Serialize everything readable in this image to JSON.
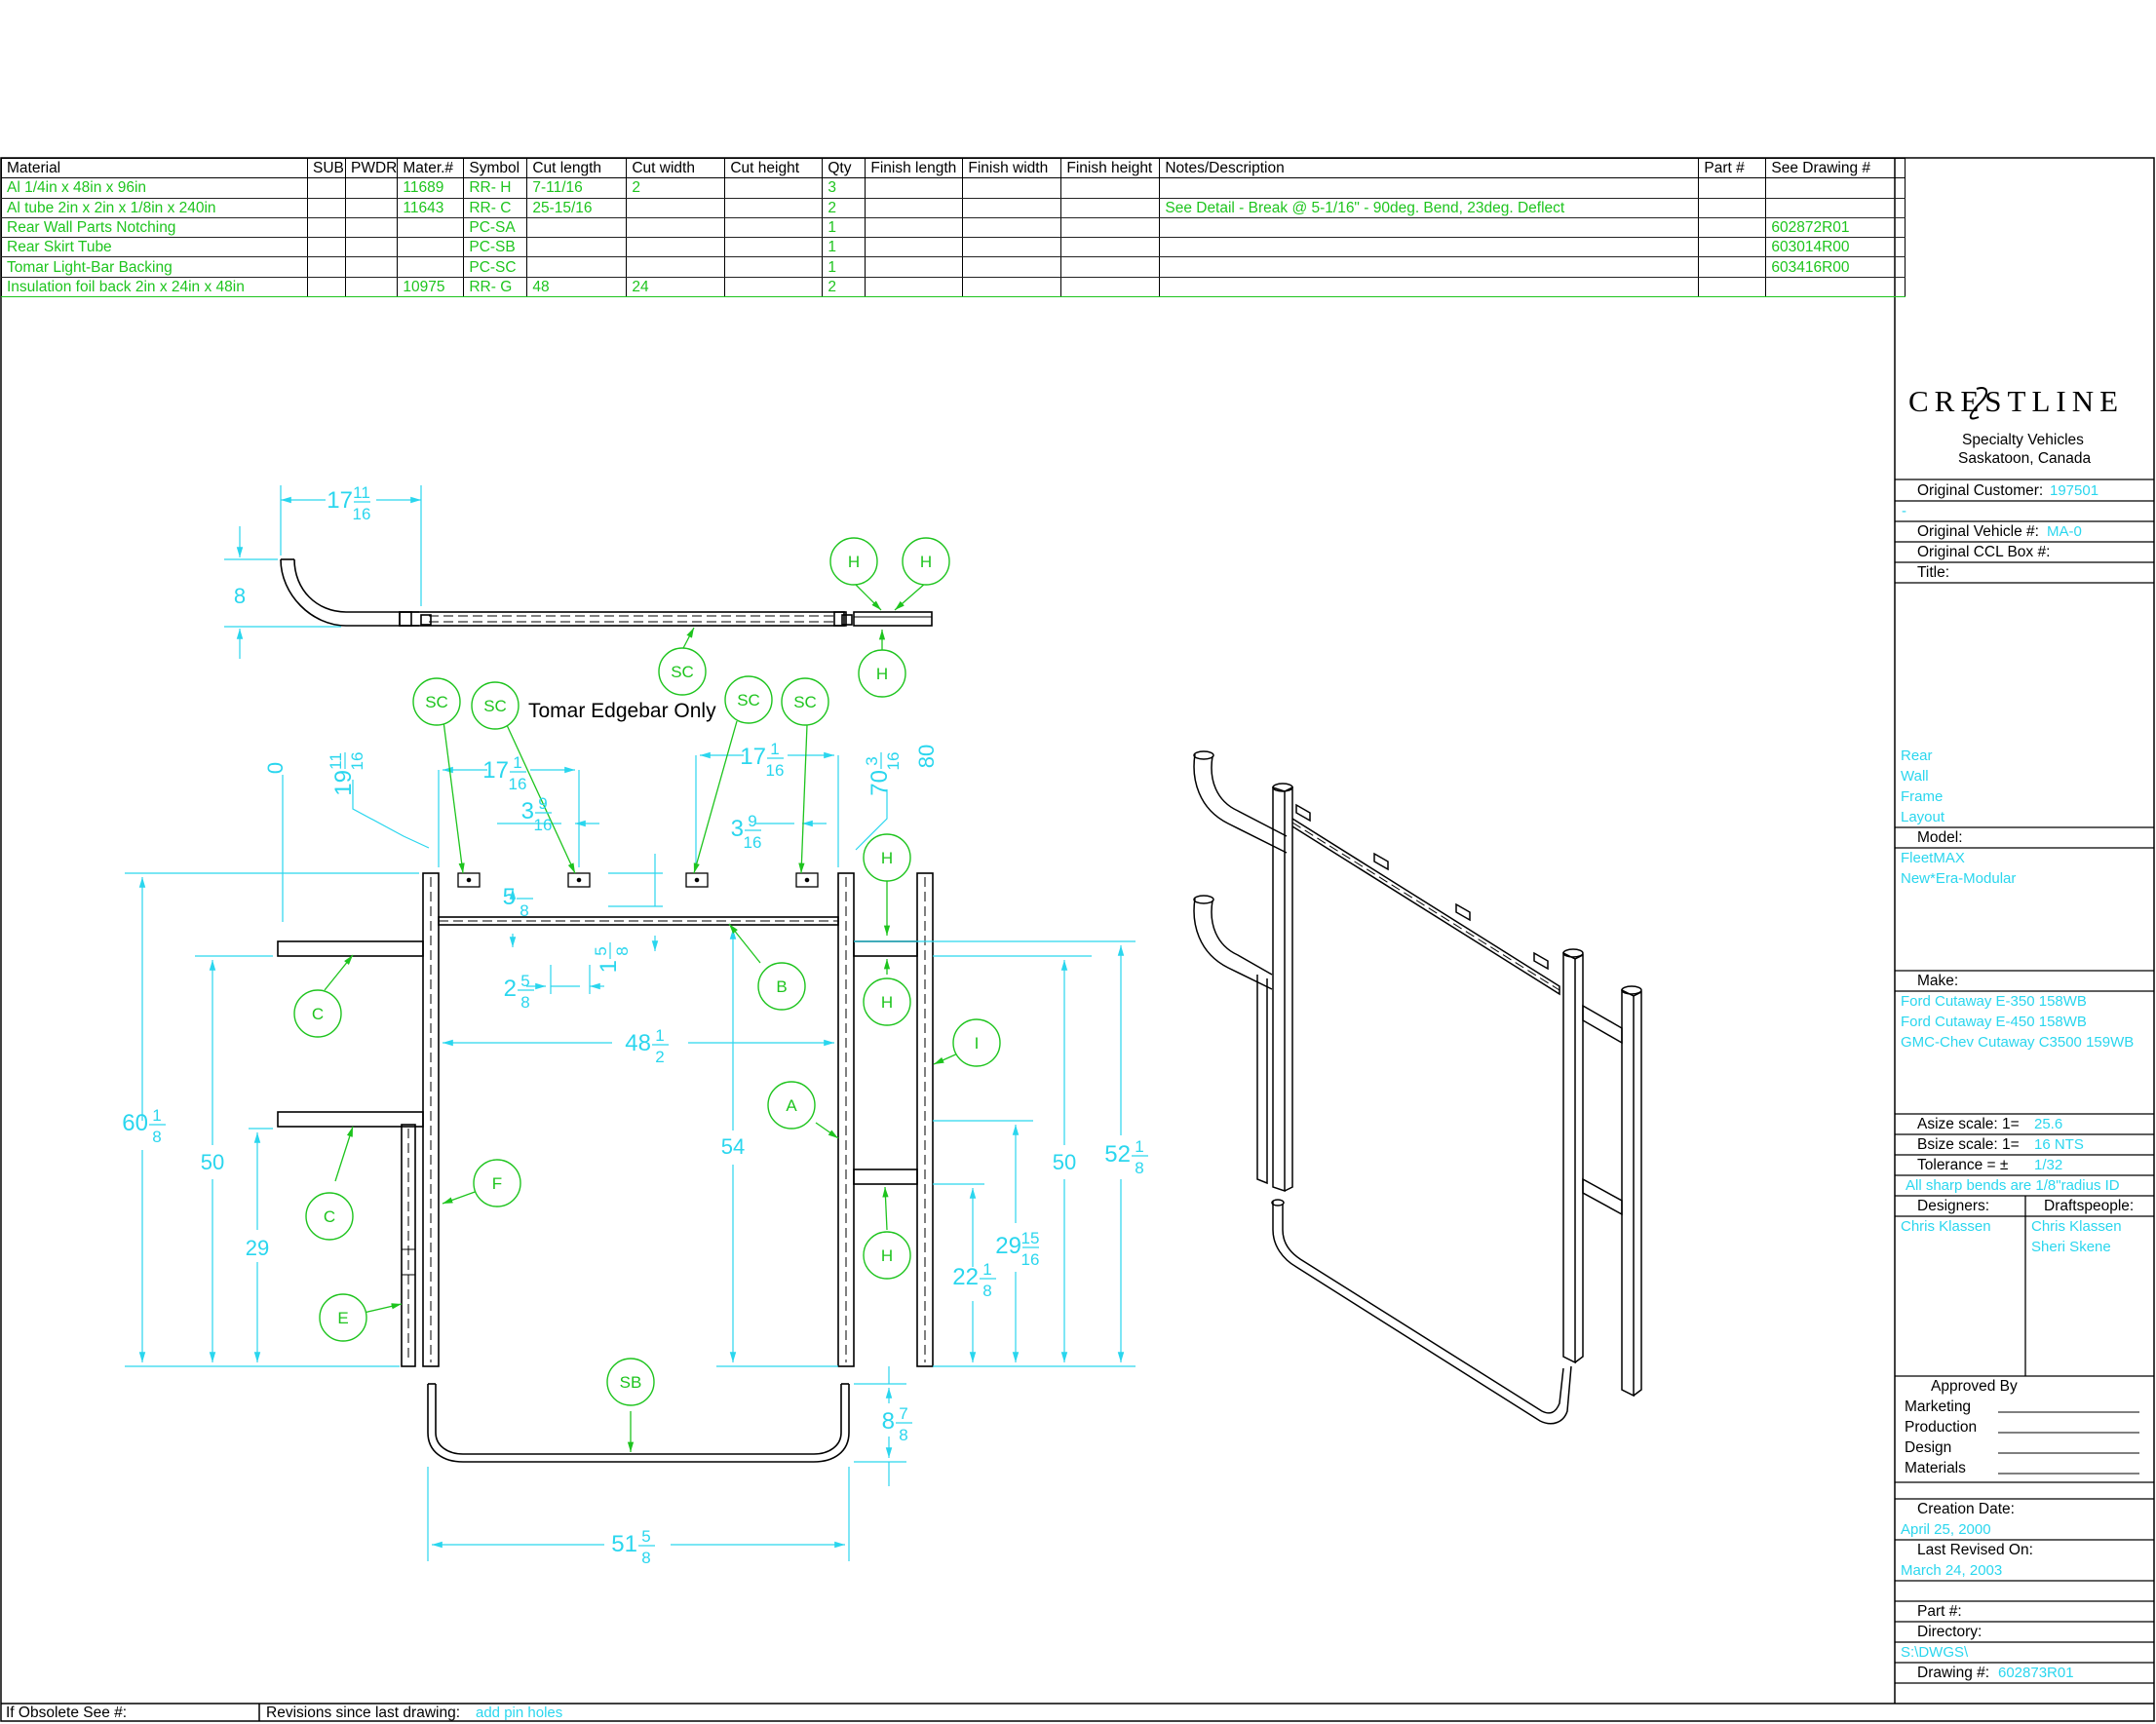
{
  "bom": {
    "headers": [
      "Material",
      "SUB",
      "PWDR",
      "Mater.#",
      "Symbol",
      "Cut length",
      "Cut width",
      "Cut height",
      "Qty",
      "Finish length",
      "Finish width",
      "Finish height",
      "Notes/Description",
      "Part #",
      "See Drawing #"
    ],
    "rows": [
      [
        "Al 1/4in x 48in x 96in",
        "",
        "",
        "11689",
        "RR- H",
        "7-11/16",
        "2",
        "",
        "3",
        "",
        "",
        "",
        "",
        "",
        ""
      ],
      [
        "Al tube 2in x 2in x 1/8in x 240in",
        "",
        "",
        "11643",
        "RR- C",
        "25-15/16",
        "",
        "",
        "2",
        "",
        "",
        "",
        "See Detail - Break @ 5-1/16\" - 90deg. Bend, 23deg. Deflect",
        "",
        ""
      ],
      [
        "Rear Wall Parts Notching",
        "",
        "",
        "",
        "PC-SA",
        "",
        "",
        "",
        "1",
        "",
        "",
        "",
        "",
        "",
        "602872R01"
      ],
      [
        "Rear Skirt Tube",
        "",
        "",
        "",
        "PC-SB",
        "",
        "",
        "",
        "1",
        "",
        "",
        "",
        "",
        "",
        "603014R00"
      ],
      [
        "Tomar Light-Bar Backing",
        "",
        "",
        "",
        "PC-SC",
        "",
        "",
        "",
        "1",
        "",
        "",
        "",
        "",
        "",
        "603416R00"
      ],
      [
        "Insulation foil back 2in x 24in x 48in",
        "",
        "",
        "10975",
        "RR- G",
        "48",
        "24",
        "",
        "2",
        "",
        "",
        "",
        "",
        "",
        ""
      ]
    ]
  },
  "title_block": {
    "company": "CRESTLINE",
    "company_sub1": "Specialty Vehicles",
    "company_sub2": "Saskatoon, Canada",
    "original_customer_label": "Original Customer:",
    "original_customer": "197501",
    "dash": "-",
    "original_vehicle_label": "Original Vehicle #:",
    "original_vehicle": "MA-0",
    "original_ccl_label": "Original CCL Box #:",
    "title_label": "Title:",
    "title_lines": [
      "Rear",
      "Wall",
      "Frame",
      "Layout"
    ],
    "model_label": "Model:",
    "model_lines": [
      "FleetMAX",
      "New*Era-Modular"
    ],
    "make_label": "Make:",
    "make_lines": [
      "Ford Cutaway E-350 158WB",
      "Ford Cutaway E-450 158WB",
      "GMC-Chev Cutaway C3500 159WB"
    ],
    "asize_label": "Asize scale:  1=",
    "asize": "25.6",
    "bsize_label": "Bsize scale:  1=",
    "bsize": "16 NTS",
    "tolerance_label": "Tolerance = ±",
    "tolerance": "1/32",
    "bends_note": "All sharp bends are 1/8\"radius ID",
    "designers_label": "Designers:",
    "draftspeople_label": "Draftspeople:",
    "designer": "Chris Klassen",
    "draftspeople": [
      "Chris Klassen",
      "Sheri Skene"
    ],
    "approved_label": "Approved By",
    "approvals": [
      "Marketing",
      "Production",
      "Design",
      "Materials"
    ],
    "creation_label": "Creation Date:",
    "creation_date": "April 25, 2000",
    "revised_label": "Last Revised On:",
    "revised_date": "March 24, 2003",
    "part_label": "Part #:",
    "directory_label": "Directory:",
    "directory": "S:\\DWGS\\",
    "drawing_label": "Drawing #:",
    "drawing_no": "602873R01"
  },
  "footer": {
    "obsolete_label": "If Obsolete See #:",
    "revisions_label": "Revisions since last drawing:",
    "revisions": "add pin holes"
  },
  "drawing": {
    "note": "Tomar Edgebar Only",
    "top_view": {
      "dim_top": {
        "whole": "17",
        "num": "11",
        "den": "16"
      },
      "dim_left": "8",
      "balloons": [
        "H",
        "H",
        "SC",
        "H"
      ]
    },
    "front_view": {
      "balloons": [
        "SC",
        "SC",
        "SC",
        "SC",
        "H",
        "H",
        "H",
        "B",
        "A",
        "I",
        "C",
        "C",
        "F",
        "E",
        "SB"
      ],
      "dims": {
        "zero": "0",
        "d19": {
          "whole": "19",
          "num": "11",
          "den": "16"
        },
        "d70": {
          "whole": "70",
          "num": "3",
          "den": "16"
        },
        "d80": "80",
        "d17a": {
          "whole": "17",
          "num": "1",
          "den": "16"
        },
        "d17b": {
          "whole": "17",
          "num": "1",
          "den": "16"
        },
        "d3a": {
          "whole": "3",
          "num": "9",
          "den": "16"
        },
        "d3b": {
          "whole": "3",
          "num": "9",
          "den": "16"
        },
        "d5": {
          "whole": "5",
          "num": "",
          "den": "8"
        },
        "d1": {
          "whole": "1",
          "num": "5",
          "den": "8"
        },
        "d2": {
          "whole": "2",
          "num": "5",
          "den": "8"
        },
        "d48": {
          "whole": "48",
          "num": "1",
          "den": "2"
        },
        "d60": {
          "whole": "60",
          "num": "1",
          "den": "8"
        },
        "d50a": "50",
        "d29": "29",
        "d54": "54",
        "d50b": "50",
        "d52": {
          "whole": "52",
          "num": "1",
          "den": "8"
        },
        "d29b": {
          "whole": "29",
          "num": "15",
          "den": "16"
        },
        "d22": {
          "whole": "22",
          "num": "1",
          "den": "8"
        },
        "d8": {
          "whole": "8",
          "num": "7",
          "den": "8"
        },
        "d51": {
          "whole": "51",
          "num": "5",
          "den": "8"
        }
      }
    }
  },
  "colors": {
    "ink": "#000000",
    "dim": "#2ad6ee",
    "callout": "#1ec41e",
    "bom_value": "#1ec41e"
  }
}
